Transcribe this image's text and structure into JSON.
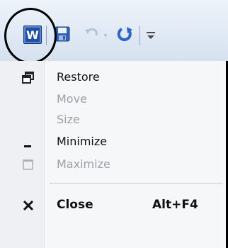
{
  "quick_access_toolbar": {
    "app_icon": "W",
    "items": [
      "word-app-icon",
      "save-icon",
      "undo-icon",
      "redo-icon",
      "customize-icon"
    ]
  },
  "system_menu": {
    "items": [
      {
        "label": "Restore",
        "enabled": true,
        "icon": "restore-icon"
      },
      {
        "label": "Move",
        "enabled": false,
        "icon": ""
      },
      {
        "label": "Size",
        "enabled": false,
        "icon": ""
      },
      {
        "label": "Minimize",
        "enabled": true,
        "icon": "minimize-icon"
      },
      {
        "label": "Maximize",
        "enabled": false,
        "icon": "maximize-icon"
      },
      {
        "label": "Close",
        "enabled": true,
        "icon": "close-icon",
        "shortcut": "Alt+F4"
      }
    ]
  }
}
